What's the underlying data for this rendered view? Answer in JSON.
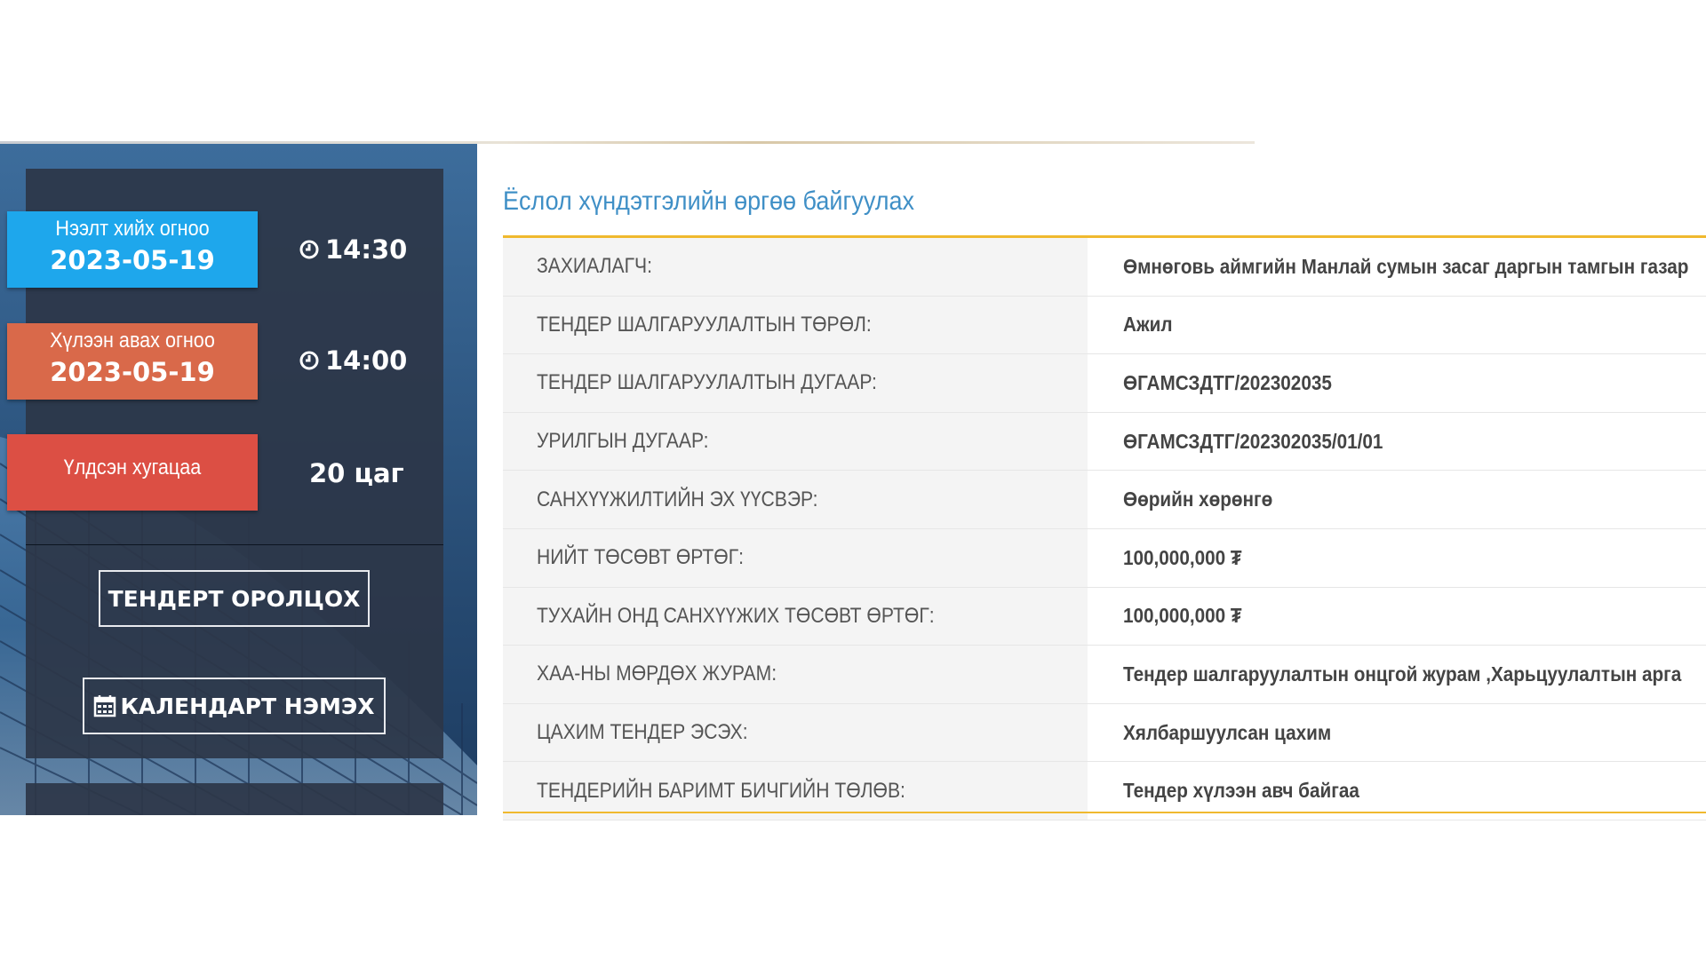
{
  "panel": {
    "opening": {
      "label": "Нээлт хийх огноо",
      "date": "2023-05-19",
      "time": "14:30"
    },
    "receiving": {
      "label": "Хүлээн авах огноо",
      "date": "2023-05-19",
      "time": "14:00"
    },
    "remaining": {
      "label": "Үлдсэн хугацаа",
      "value": "20 цаг"
    },
    "participate_button": "ТЕНДЕРТ ОРОЛЦОХ",
    "calendar_button": "КАЛЕНДАРТ НЭМЭХ"
  },
  "content": {
    "title": "Ёслол хүндэтгэлийн өргөө байгуулах",
    "rows": [
      {
        "key": "ЗАХИАЛАГЧ:",
        "value": "Өмнөговь аймгийн Манлай сумын засаг даргын тамгын газар"
      },
      {
        "key": "ТЕНДЕР ШАЛГАРУУЛАЛТЫН ТӨРӨЛ:",
        "value": "Ажил"
      },
      {
        "key": "ТЕНДЕР ШАЛГАРУУЛАЛТЫН ДУГААР:",
        "value": "ӨГАМСЗДТГ/202302035"
      },
      {
        "key": "УРИЛГЫН ДУГААР:",
        "value": "ӨГАМСЗДТГ/202302035/01/01"
      },
      {
        "key": "САНХҮҮЖИЛТИЙН ЭХ ҮҮСВЭР:",
        "value": "Өөрийн хөрөнгө"
      },
      {
        "key": "НИЙТ ТӨСӨВТ ӨРТӨГ:",
        "value": "100,000,000 ₮"
      },
      {
        "key": "ТУХАЙН ОНД САНХҮҮЖИХ ТӨСӨВТ ӨРТӨГ:",
        "value": "100,000,000 ₮"
      },
      {
        "key": "ХАА-НЫ МӨРДӨХ ЖУРАМ:",
        "value": "Тендер шалгаруулалтын онцгой журам ,Харьцуулалтын арга"
      },
      {
        "key": "ЦАХИМ ТЕНДЕР ЭСЭХ:",
        "value": "Хялбаршуулсан цахим"
      },
      {
        "key": "ТЕНДЕРИЙН БАРИМТ БИЧГИЙН ТӨЛӨВ:",
        "value": "Тендер хүлээн авч байгаа"
      }
    ]
  },
  "colors": {
    "opening_badge": "#1ea7ec",
    "receiving_badge": "#d9694a",
    "remaining_badge": "#dc4f44",
    "title": "#3f8fc6",
    "accent_rule": "#f0b92e"
  },
  "icons": [
    "clock-icon",
    "calendar-icon"
  ]
}
